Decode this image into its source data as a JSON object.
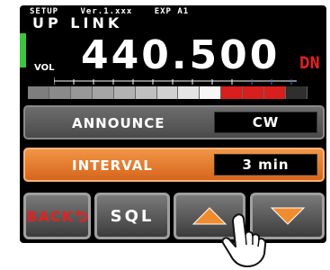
{
  "header": {
    "setup": "SETUP",
    "version": "Ver.1.xxx",
    "exp": "EXP A1"
  },
  "display": {
    "mode": "UP LINK",
    "vol_label": "VOL",
    "frequency": "440.500",
    "direction": "DN"
  },
  "meter": {
    "segment_colors": [
      "#7e7e7e",
      "#8a8a8a",
      "#989898",
      "#a5a5a5",
      "#b2b2b2",
      "#c0c0c0",
      "#d0d0d0",
      "#e4e4e4",
      "#f6f6f6",
      "#d91e1e",
      "#d91e1e",
      "#d91e1e",
      "#2f2f2f"
    ]
  },
  "menu": {
    "announce": {
      "label": "ANNOUNCE",
      "value": "CW"
    },
    "interval": {
      "label": "INTERVAL",
      "value": "3 min"
    }
  },
  "buttons": {
    "back": "BACK",
    "sql": "SQL"
  },
  "colors": {
    "accent_orange": "#e87a2c",
    "alert_red": "#e02020",
    "vol_green": "#3cc63c"
  }
}
